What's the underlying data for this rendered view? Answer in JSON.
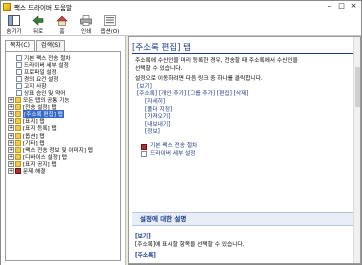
{
  "window": {
    "title": "팩스 드라이버 도움말"
  },
  "toolbar": [
    {
      "label": "숨기기",
      "icon": "hide-icon"
    },
    {
      "label": "뒤로",
      "icon": "back-icon"
    },
    {
      "label": "홈",
      "icon": "home-icon"
    },
    {
      "label": "인쇄",
      "icon": "print-icon"
    },
    {
      "label": "옵션(O)",
      "icon": "options-icon"
    }
  ],
  "tabs": {
    "contents": "목차(C)",
    "search": "검색(S)"
  },
  "tree": [
    {
      "label": "기본 팩스 전송 절차",
      "type": "page",
      "indent": 1
    },
    {
      "label": "드라이버 세부 설정",
      "type": "page",
      "indent": 1
    },
    {
      "label": "프로파일 설정",
      "type": "page",
      "indent": 1
    },
    {
      "label": "경의 요건 설정",
      "type": "page",
      "indent": 1
    },
    {
      "label": "고지 사항",
      "type": "page",
      "indent": 1
    },
    {
      "label": "상표 승인 및 약어",
      "type": "page",
      "indent": 1
    },
    {
      "label": "모든 탭의 공통 기능",
      "type": "folder",
      "indent": 0
    },
    {
      "label": "[전송 설정] 탭",
      "type": "folder",
      "indent": 0
    },
    {
      "label": "[주소록 편집] 탭",
      "type": "folder",
      "indent": 0,
      "selected": true
    },
    {
      "label": "[표지] 탭",
      "type": "folder",
      "indent": 0
    },
    {
      "label": "[표지 등록] 탭",
      "type": "folder",
      "indent": 0
    },
    {
      "label": "[옵션] 탭",
      "type": "folder",
      "indent": 0
    },
    {
      "label": "[기타] 탭",
      "type": "folder",
      "indent": 0
    },
    {
      "label": "[팩스 전송 정보 및 이미지] 탭",
      "type": "folder",
      "indent": 0
    },
    {
      "label": "[디바이스 설정] 탭",
      "type": "folder",
      "indent": 0
    },
    {
      "label": "[표지 공지] 탭",
      "type": "folder",
      "indent": 0
    },
    {
      "label": "문제 해결",
      "type": "book",
      "indent": 0
    }
  ],
  "content": {
    "title": "[주소록 편집] 탭",
    "intro_1": "주소록에 수신인을 미리 등록한 경우, 전송할 때 주소록에서 수신인을",
    "intro_2": "선택할 수 있습니다.",
    "intro_3": "설정으로 이동하려면 다음 링크 중 하나를 클릭합니다.",
    "links": [
      {
        "text": "[보기]",
        "sub": false
      },
      {
        "text": "[주소록] [개인 추가] [그룹 추가] [편집] [삭제]",
        "sub": false
      },
      {
        "text": "[자세히]",
        "sub": true
      },
      {
        "text": "[폴더 지정]",
        "sub": true
      },
      {
        "text": "[가져오기]",
        "sub": true
      },
      {
        "text": "[내보내기]",
        "sub": true
      },
      {
        "text": "[정보]",
        "sub": true
      }
    ],
    "related": [
      {
        "text": "기본 팩스 전송 절차",
        "icon": "book-icon"
      },
      {
        "text": "드라이버 세부 설정",
        "icon": "page-icon"
      }
    ],
    "section_header": "설정에 대한 설명",
    "section_item_title": "[보기]",
    "section_item_text": "[주소록]에 표시할 항목을 선택할 수 있습니다.",
    "section_next": "[주소록]"
  }
}
